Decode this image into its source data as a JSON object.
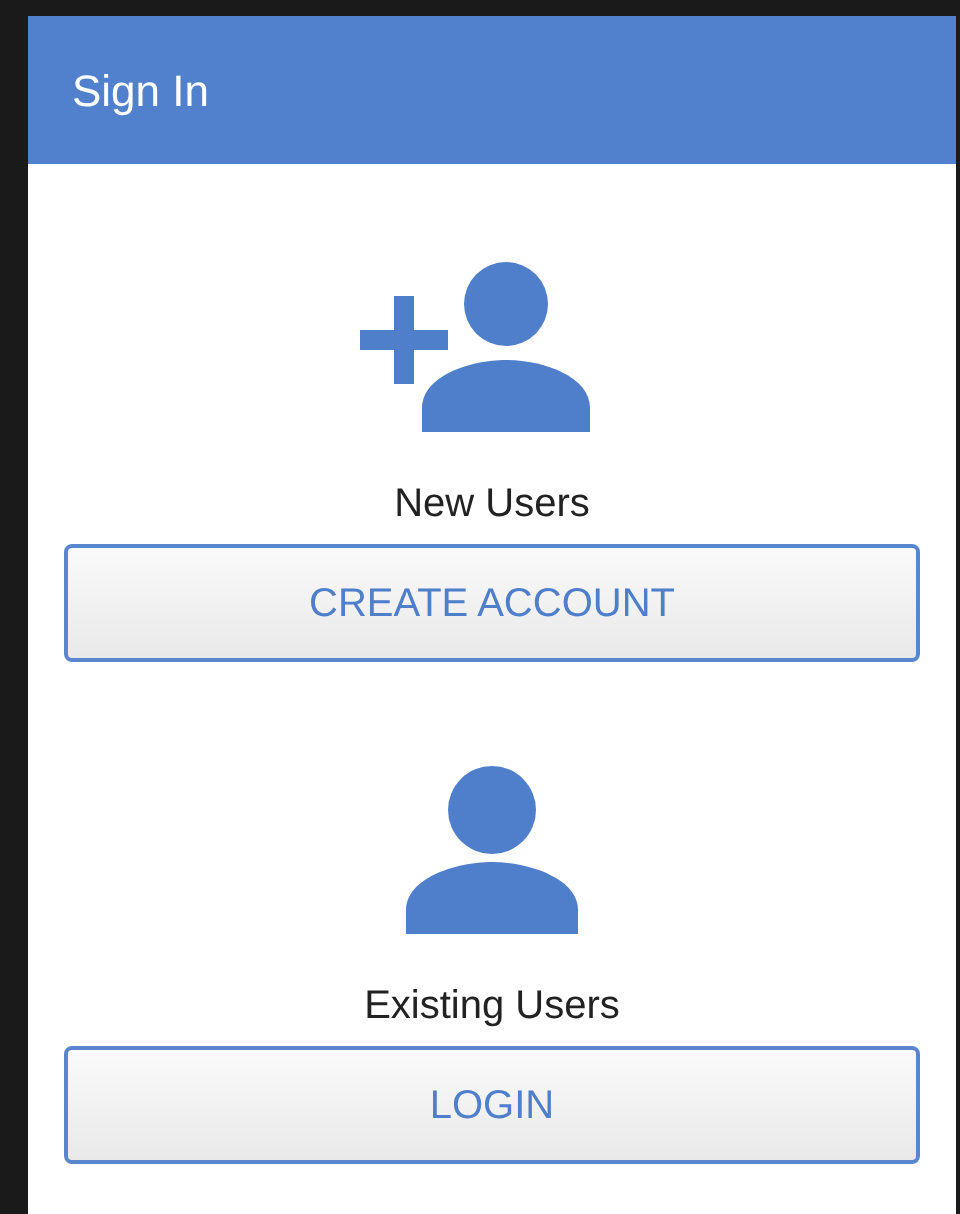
{
  "header": {
    "title": "Sign In"
  },
  "sections": [
    {
      "kind": "add_user",
      "label": "New Users",
      "button": "CREATE ACCOUNT"
    },
    {
      "kind": "user",
      "label": "Existing Users",
      "button": "LOGIN"
    }
  ]
}
